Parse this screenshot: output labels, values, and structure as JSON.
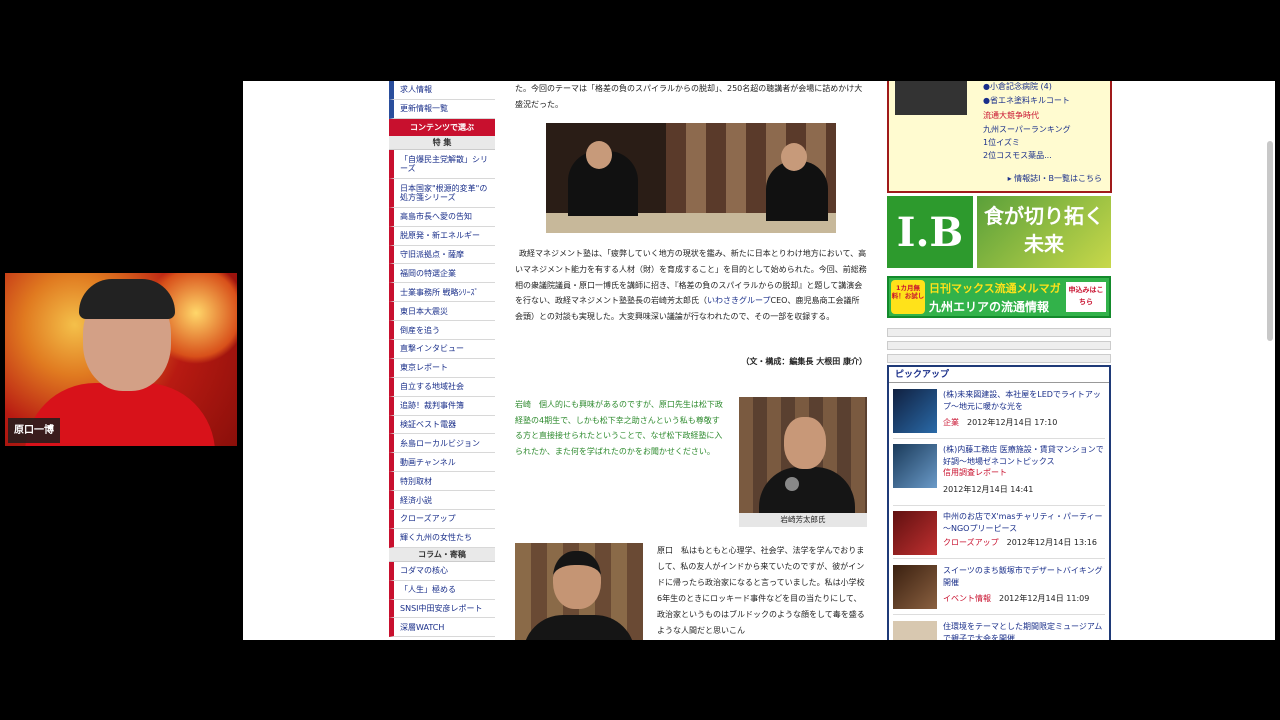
{
  "left_nav": {
    "top_items": [
      "求人情報",
      "更新情報一覧"
    ],
    "contents_header": "コンテンツで選ぶ",
    "feature_header": "特 集",
    "items": [
      "「自爆民主党解散」シリーズ",
      "日本国家\"根源的変革\"の処方箋シリーズ",
      "高島市長へ愛の告知",
      "脱原発・新エネルギー",
      "守旧派拠点・薩摩",
      "福岡の特選企業",
      "士業事務所 戦略ｼﾘｰｽﾞ",
      "東日本大震災",
      "倒産を追う",
      "直撃インタビュー",
      "東京レポート",
      "自立する地域社会",
      "追跡！裁判事件簿",
      "検証ベスト電器",
      "糸島ローカルビジョン",
      "動画チャンネル",
      "特別取材",
      "経済小説",
      "クローズアップ",
      "輝く九州の女性たち"
    ],
    "column_header": "コラム・寄稿",
    "column_items": [
      "コダマの核心",
      "「人生」極める",
      "SNSI中田安彦レポート",
      "深層WATCH"
    ]
  },
  "article": {
    "intro": "た。今回のテーマは「格差の負のスパイラルからの脱却」、250名超の聴講者が会場に詰めかけ大盛況だった。",
    "body": "政経マネジメント塾は、「疲弊していく地方の現状を鑑み、新たに日本とりわけ地方において、高いマネジメント能力を有する人材（財）を育成すること」を目的として始められた。今回、前総務相の衆議院議員・原口一博氏を講師に招き、『格差の負のスパイラルからの脱却』と題して講演会を行ない、政経マネジメント塾塾長の岩崎芳太郎氏（",
    "link": "いわさきグループ",
    "body_after_link": "CEO、鹿児島商工会議所会頭）との対談も実現した。大変興味深い議論が行なわれたので、その一部を収録する。",
    "credit": "（文・構成：編集長 大根田 康介）",
    "quote": "岩崎　個人的にも興味があるのですが、原口先生は松下政経塾の4期生で、しかも松下幸之助さんという私も尊敬する方と直接接せられたということで、なぜ松下政経塾に入られたか、また何を学ばれたのかをお聞かせください。",
    "caption": "岩崎芳太郎氏",
    "haraguchi_text": "原口　私はもともと心理学、社会学、法学を学んでおりまして、私の友人がインドから来ていたのですが、彼がインドに帰ったら政治家になると言っていました。私は小学校6年生のときにロッキード事件などを目の当たりにして、政治家というものはブルドックのような顔をして毒を盛るような人間だと思いこん"
  },
  "info_box": {
    "lines": [
      "●小倉記念病院 (4)",
      "●省エネ塗料キルコート",
      "流通大競争時代",
      "九州スーパーランキング",
      "1位イズミ",
      "2位コスモス薬品..."
    ],
    "more": "情報誌I・B一覧はこちら"
  },
  "banners": {
    "ib": "I.B",
    "food_line1": "食が切り拓く",
    "food_line2": "未来",
    "mag_badge": "1カ月無料！お試し",
    "mag_title": "日刊マックス流通メルマガ",
    "mag_sub": "九州エリアの流通情報",
    "mag_apply": "申込みはこちら"
  },
  "pickup": {
    "title": "ピックアップ",
    "items": [
      {
        "title": "(株)未来図建設、本社屋をLEDでライトアップ～地元に暖かな光を",
        "category": "企業",
        "date": "2012年12月14日 17:10"
      },
      {
        "title": "(株)内藤工務店 医療施設・賃貸マンションで好調～地場ゼネコントピックス",
        "category": "信用調査レポート",
        "date": "2012年12月14日 14:41"
      },
      {
        "title": "中州のお店でX'masチャリティ・パーティー～NGOプリーピース",
        "category": "クローズアップ",
        "date": "2012年12月14日 13:16"
      },
      {
        "title": "スイーツのまち飯塚市でデザートバイキング開催",
        "category": "イベント情報",
        "date": "2012年12月14日 11:09"
      },
      {
        "title": "住環境をテーマとした期間限定ミュージアムで親子で大会を開催",
        "category": "",
        "date": ""
      }
    ]
  },
  "webcam": {
    "name": "原口一博"
  }
}
